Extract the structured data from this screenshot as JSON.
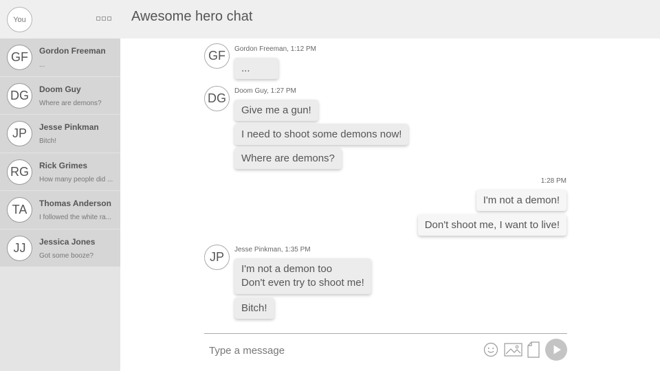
{
  "app": {
    "self_label": "You",
    "chat_title": "Awesome hero chat"
  },
  "contacts": [
    {
      "initials": "GF",
      "name": "Gordon Freeman",
      "preview": "..."
    },
    {
      "initials": "DG",
      "name": "Doom Guy",
      "preview": "Where are demons?"
    },
    {
      "initials": "JP",
      "name": "Jesse Pinkman",
      "preview": "Bitch!"
    },
    {
      "initials": "RG",
      "name": "Rick Grimes",
      "preview": "How many people did ..."
    },
    {
      "initials": "TA",
      "name": "Thomas Anderson",
      "preview": "I followed the white ra..."
    },
    {
      "initials": "JJ",
      "name": "Jessica Jones",
      "preview": "Got some booze?"
    }
  ],
  "messages": {
    "g1": {
      "initials": "GF",
      "meta": "Gordon Freeman, 1:12 PM",
      "texts": [
        "..."
      ]
    },
    "g2": {
      "initials": "DG",
      "meta": "Doom Guy, 1:27 PM",
      "texts": [
        "Give me a gun!",
        "I need to shoot some demons now!",
        "Where are demons?"
      ]
    },
    "g3": {
      "meta": "1:28 PM",
      "texts": [
        "I'm not a demon!",
        "Don't shoot me, I want to live!"
      ]
    },
    "g4": {
      "initials": "JP",
      "meta": "Jesse Pinkman, 1:35 PM",
      "texts": [
        "I'm not a demon too",
        "Don't even try to shoot me!",
        "Bitch!"
      ]
    }
  },
  "composer": {
    "placeholder": "Type a message"
  },
  "icons": {
    "menu": "more-dots-icon",
    "emoji": "smiley-icon",
    "image": "image-icon",
    "file": "file-icon",
    "send": "send-play-icon"
  }
}
